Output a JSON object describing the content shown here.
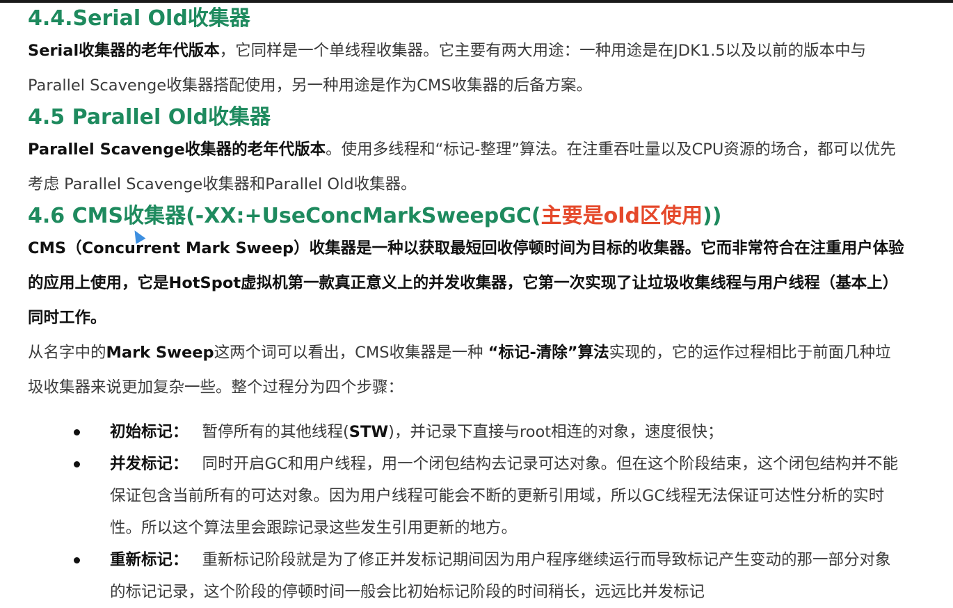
{
  "sections": [
    {
      "heading": "4.4.Serial Old收集器",
      "lead_bold": "Serial收集器的老年代版本",
      "text": "，它同样是一个单线程收集器。它主要有两大用途：一种用途是在JDK1.5以及以前的版本中与Parallel Scavenge收集器搭配使用，另一种用途是作为CMS收集器的后备方案。"
    },
    {
      "heading": "4.5 Parallel Old收集器",
      "lead_bold": "Parallel Scavenge收集器的老年代版本",
      "text": "。使用多线程和“标记-整理”算法。在注重吞吐量以及CPU资源的场合，都可以优先考虑 Parallel Scavenge收集器和Parallel Old收集器。"
    },
    {
      "heading_main": "4.6 CMS收集器(-XX:+UseConcMarkSweepGC(",
      "heading_highlight": "主要是old区使用",
      "heading_end": "))",
      "bold_para": "CMS（Concurrent Mark Sweep）收集器是一种以获取最短回收停顿时间为目标的收集器。它而非常符合在注重用户体验的应用上使用，它是HotSpot虚拟机第一款真正意义上的并发收集器，它第一次实现了让垃圾收集线程与用户线程（基本上）同时工作。",
      "intro_1": "从名字中的",
      "intro_bold_1": "Mark Sweep",
      "intro_2": "这两个词可以看出，CMS收集器是一种 ",
      "intro_bold_2": "“标记-清除”算法",
      "intro_3": "实现的，它的运作过程相比于前面几种垃圾收集器来说更加复杂一些。整个过程分为四个步骤："
    }
  ],
  "steps": [
    {
      "term": "初始标记：",
      "text_1": "暂停所有的其他线程(",
      "text_bold": "STW",
      "text_2": ")，并记录下直接与root相连的对象，速度很快；"
    },
    {
      "term": "并发标记：",
      "text_1": "同时开启GC和用户线程，用一个闭包结构去记录可达对象。但在这个阶段结束，这个闭包结构并不能保证包含当前所有的可达对象。因为用户线程可能会不断的更新引用域，所以GC线程无法保证可达性分析的实时性。所以这个算法里会跟踪记录这些发生引用更新的地方。"
    },
    {
      "term": "重新标记：",
      "text_1": "重新标记阶段就是为了修正并发标记期间因为用户程序继续运行而导致标记产生变动的那一部分对象的标记记录，这个阶段的停顿时间一般会比初始标记阶段的时间稍长，远远比并发标记"
    }
  ],
  "colors": {
    "heading": "#1e8a5e",
    "highlight": "#e5492b",
    "cursor": "#3d8fe0"
  }
}
